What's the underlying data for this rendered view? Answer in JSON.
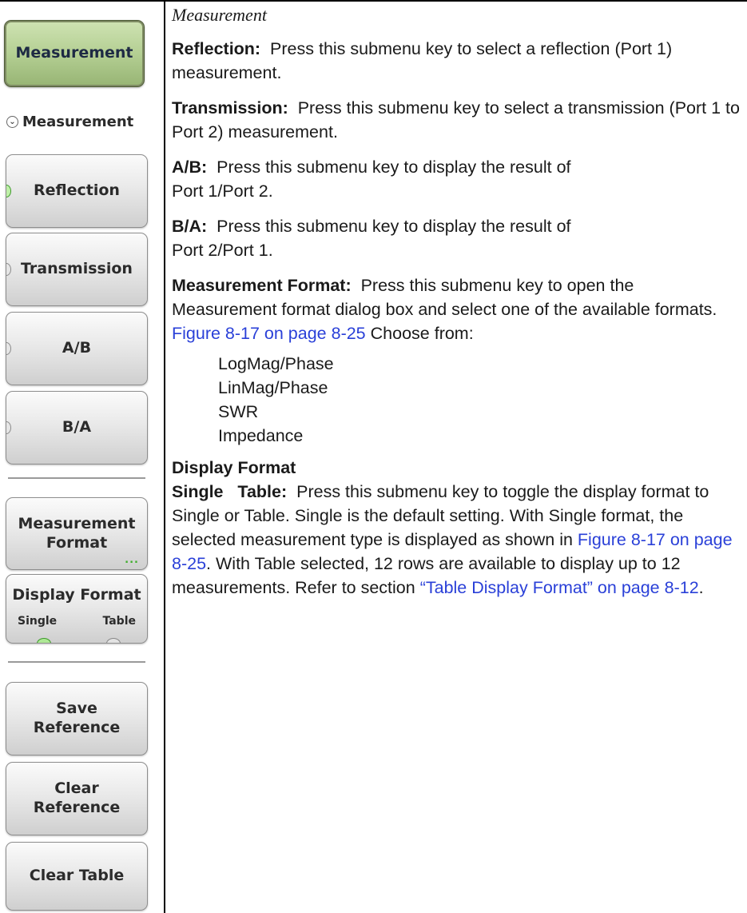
{
  "left_menu": {
    "main_button": "Measurement",
    "menu_title": "Measurement",
    "keys": {
      "reflection": "Reflection",
      "transmission": "Transmission",
      "a_over_b": "A/B",
      "b_over_a": "B/A",
      "measurement_format_line1": "Measurement",
      "measurement_format_line2": "Format",
      "display_format": "Display Format",
      "display_format_single": "Single",
      "display_format_table": "Table",
      "save_reference_line1": "Save",
      "save_reference_line2": "Reference",
      "clear_reference_line1": "Clear",
      "clear_reference_line2": "Reference",
      "clear_table": "Clear Table"
    },
    "more_indicator": "...",
    "accent_colors": {
      "main_button": "#b4cf93",
      "led_on": "#3d9a2a",
      "link": "#2a40d8"
    }
  },
  "content": {
    "heading": "Measurement",
    "reflection_term": "Reflection:",
    "reflection_text": "Press this submenu key to select a reflection (Port 1) measurement.",
    "transmission_term": "Transmission:",
    "transmission_text": "Press this submenu key to select a transmission (Port 1 to Port 2) measurement.",
    "ab_term": "A/B:",
    "ab_text_1": "Press this submenu key to display the result of",
    "ab_text_2": "Port 1/Port 2.",
    "ba_term": "B/A:",
    "ba_text_1": "Press this submenu key to display the result of",
    "ba_text_2": "Port 2/Port 1.",
    "mf_term": "Measurement Format:",
    "mf_text": "Press this submenu key to open the Measurement format dialog box and select one of the available formats.",
    "mf_link": "Figure 8-17 on page 8-25",
    "mf_after": "Choose from:",
    "formats": [
      "LogMag/Phase",
      "LinMag/Phase",
      "SWR",
      "Impedance"
    ],
    "df_heading": "Display Format",
    "df_term": "Single   Table:",
    "df_text_1": "Press this submenu key to toggle the display format to Single or Table. Single is the default setting. With Single format, the selected measurement type is displayed as shown in",
    "df_link_1": "Figure 8-17 on page 8-25",
    "df_text_2": ". With Table selected, 12 rows are available to display up to 12 measurements. Refer to section",
    "df_link_2": "“Table Display Format” on page 8-12",
    "df_end": "."
  }
}
